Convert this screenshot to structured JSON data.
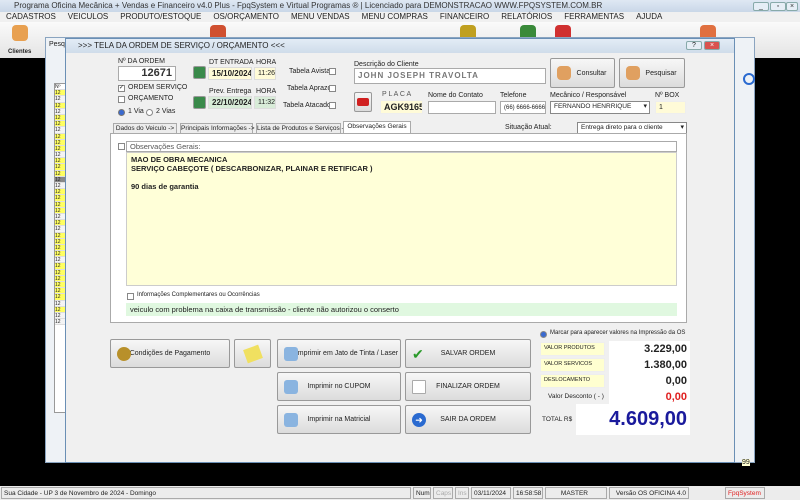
{
  "app": {
    "title": "Programa Oficina Mecânica + Vendas e Financeiro v4.0 Plus - FpqSystem e Virtual Programas ® | Licenciado para  DEMONSTRACAO WWW.FPQSYSTEM.COM.BR"
  },
  "menu": [
    "CADASTROS",
    "VEICULOS",
    "PRODUTO/ESTOQUE",
    "OS/ORÇAMENTO",
    "MENU VENDAS",
    "MENU COMPRAS",
    "FINANCEIRO",
    "RELATÓRIOS",
    "FERRAMENTAS",
    "AJUDA"
  ],
  "toolbar": {
    "clientes_label": "Clientes"
  },
  "bgwindow": {
    "title": "Pesqu",
    "grid_header": "Nº",
    "row_value": "12",
    "total_fragment": "99"
  },
  "dialog": {
    "title": ">>>  TELA DA ORDEM DE SERVIÇO / ORÇAMENTO  <<<",
    "order_label": "Nº DA ORDEM",
    "order_number": "12671",
    "ordem_servico": "ORDEM SERVIÇO",
    "orcamento": "ORÇAMENTO",
    "via1": "1 Via",
    "via2": "2 Vias",
    "dt_entrada_label": "DT ENTRADA",
    "hora_label": "HORA",
    "dt_entrada": "15/10/2024",
    "hora_entrada": "11:26",
    "prev_label": "Prev. Entrega",
    "prev_entrega": "22/10/2024",
    "hora_prev": "11:32",
    "tabela_avista": "Tabela Avista",
    "tabela_aprazo": "Tabela Aprazo",
    "tabela_atacado": "Tabela Atacado",
    "cliente_label": "Descrição do Cliente",
    "cliente": "JOHN JOSEPH TRAVOLTA",
    "consultar": "Consultar",
    "pesquisar": "Pesquisar",
    "placa_label": "P L A C A",
    "placa": "AGK9165",
    "contato_label": "Nome do Contato",
    "contato": "",
    "telefone_label": "Telefone",
    "telefone": "(66) 6666-6666",
    "mecanico_label": "Mecânico / Responsável",
    "mecanico": "FERNANDO HENRRIQUE",
    "box_label": "Nº BOX",
    "box": "1",
    "tabs": [
      "Dados do Veiculo ->",
      "Principais Informações ->",
      "Lista de Produtos e Serviços ->",
      "Observações Gerais"
    ],
    "situacao_label": "Situação Atual:",
    "situacao": "Entrega direto para o cliente",
    "obs_header": "Observações Gerais:",
    "obs_lines": [
      "MAO DE OBRA MECANICA",
      "SERVIÇO CABEÇOTE ( DESCARBONIZAR, PLAINAR E RETIFICAR )",
      "",
      "90 dias de garantia"
    ],
    "info_label": "Informações Complementares ou Ocorrências",
    "info_text": "veiculo com problema na caixa de transmissão - cliente não autorizou o conserto",
    "buttons": {
      "pagamento": "Condições de Pagamento",
      "jato": "Imprimir em Jato de Tinta / Laser",
      "cupom": "Imprimir no CUPOM",
      "matricial": "Imprimir na Matricial",
      "salvar": "SALVAR ORDEM",
      "finalizar": "FINALIZAR ORDEM",
      "sair": "SAIR DA ORDEM"
    },
    "marcar": "Marcar para aparecer valores na Impressão da OS",
    "valores": {
      "produtos_label": "VALOR PRODUTOS",
      "produtos": "3.229,00",
      "servicos_label": "VALOR SERVICOS",
      "servicos": "1.380,00",
      "desloc_label": "DESLOCAMENTO",
      "desloc": "0,00",
      "desconto_label": "Valor Desconto ( - )",
      "desconto": "0,00",
      "total_label": "TOTAL R$",
      "total": "4.609,00"
    }
  },
  "status": {
    "city": "Sua Cidade - UP  3 de Novembro de 2024 - Domingo",
    "num": "Num",
    "caps": "Caps",
    "ins": "Ins",
    "date": "03/11/2024",
    "time": "16:58:58",
    "user": "MASTER",
    "version": "Versão OS OFICINA 4.0",
    "brand": "FpqSystem"
  },
  "colors": {
    "total": "#1a1a9c",
    "desconto": "#e02020",
    "yellow_field": "#ffffd0",
    "green_field": "#e0f8e0"
  }
}
